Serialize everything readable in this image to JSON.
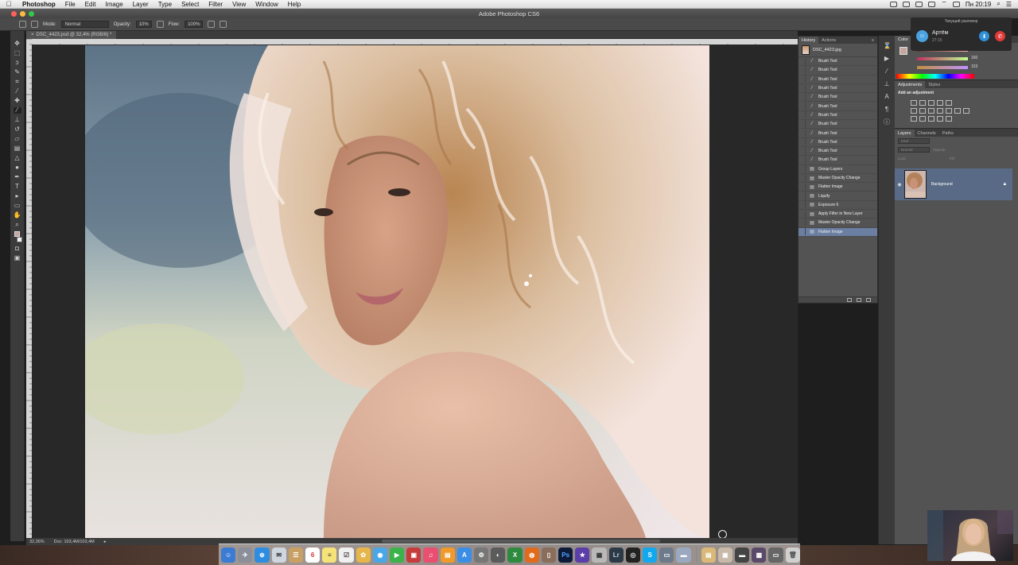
{
  "menubar": {
    "apple": "",
    "items": [
      "Photoshop",
      "File",
      "Edit",
      "Image",
      "Layer",
      "Type",
      "Select",
      "Filter",
      "View",
      "Window",
      "Help"
    ],
    "clock": "Пн 20:19"
  },
  "window": {
    "title": "Adobe Photoshop CS6"
  },
  "options": {
    "mode_label": "Mode:",
    "mode_value": "Normal",
    "opacity_label": "Opacity:",
    "opacity_value": "10%",
    "flow_label": "Flow:",
    "flow_value": "100%"
  },
  "document": {
    "tab_label": "DSC_4423.psd @ 32,4% (RGB/8) *",
    "zoom": "32,36%",
    "doc_size": "Doc: 103,4M/103,4M"
  },
  "history": {
    "tabs": [
      "History",
      "Actions"
    ],
    "snapshot": "DSC_4423.jpg",
    "items": [
      "Brush Tool",
      "Brush Tool",
      "Brush Tool",
      "Brush Tool",
      "Brush Tool",
      "Brush Tool",
      "Brush Tool",
      "Brush Tool",
      "Brush Tool",
      "Brush Tool",
      "Brush Tool",
      "Brush Tool",
      "Group Layers",
      "Master Opacity Change",
      "Flatten Image",
      "Liquify",
      "Exposure 6",
      "Apply Filter in New Layer",
      "Master Opacity Change",
      "Flatten Image"
    ],
    "selected_index": 19
  },
  "color_panel": {
    "tab": "Color",
    "values": [
      "168",
      "160",
      "153"
    ]
  },
  "adjustments": {
    "tabs": [
      "Adjustments",
      "Styles"
    ],
    "add_label": "Add an adjustment"
  },
  "layers": {
    "tabs": [
      "Layers",
      "Channels",
      "Paths"
    ],
    "kind_label": "Kind",
    "blend": "Normal",
    "opacity_label": "Opacity:",
    "lock_label": "Lock:",
    "fill_label": "Fill:",
    "layer_name": "Background"
  },
  "call": {
    "header": "Текущий разговор",
    "name": "Артём",
    "duration": "27:15"
  },
  "colors": {
    "accent": "#6b7fa3",
    "layer_selected": "#596a86",
    "panel": "#535353"
  }
}
